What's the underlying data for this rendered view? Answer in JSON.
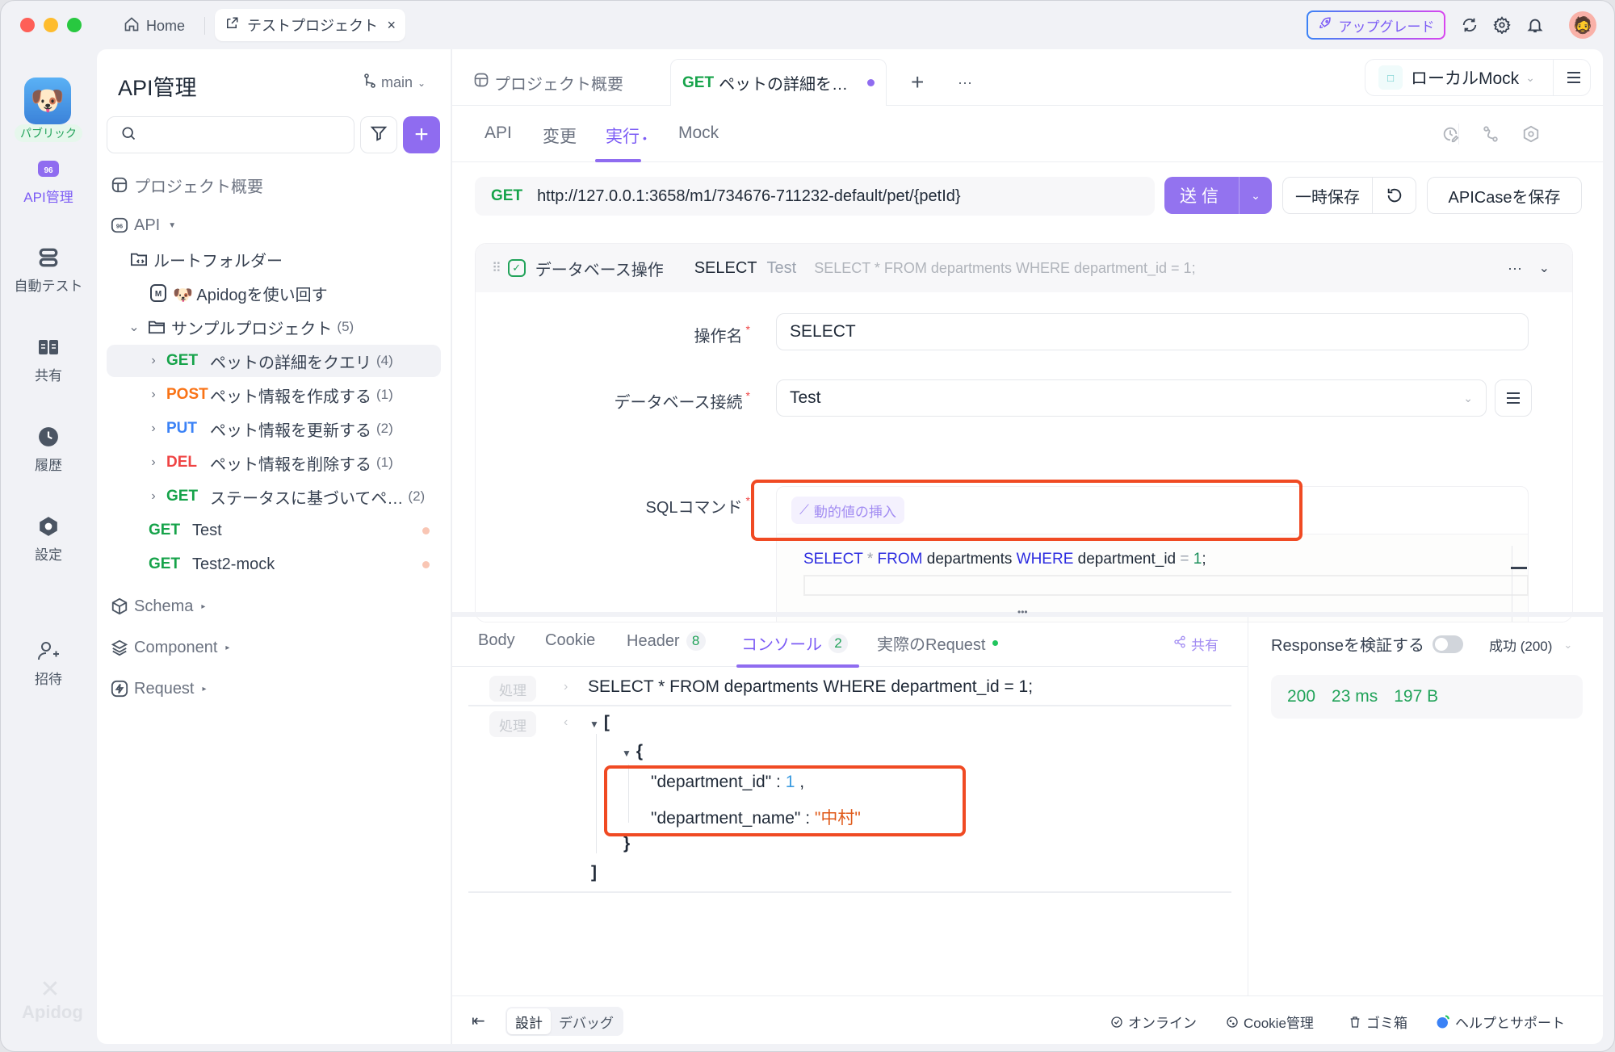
{
  "titlebar": {
    "home_tab": "Home",
    "project_tab": "テストプロジェクト",
    "close_glyph": "×",
    "upgrade_label": "アップグレード"
  },
  "rail": {
    "badge": "パブリック",
    "items": [
      {
        "label": "API管理",
        "icon": "api-icon",
        "active": true
      },
      {
        "label": "自動テスト",
        "icon": "automation-icon",
        "active": false
      },
      {
        "label": "共有",
        "icon": "book-icon",
        "active": false
      },
      {
        "label": "履歴",
        "icon": "clock-icon",
        "active": false
      },
      {
        "label": "設定",
        "icon": "settings-icon",
        "active": false
      },
      {
        "label": "招待",
        "icon": "invite-icon",
        "active": false
      }
    ],
    "footer_logo": "Apidog"
  },
  "sidebar": {
    "title": "API管理",
    "branch": "main",
    "search_placeholder": "",
    "overview": "プロジェクト概要",
    "api_label": "API",
    "root_folder": "ルートフォルダー",
    "doc_item": "🐶 Apidogを使い回す",
    "sample_folder": "サンプルプロジェクト",
    "sample_count": "(5)",
    "endpoints": [
      {
        "method": "GET",
        "name": "ペットの詳細をクエリ",
        "count": "(4)",
        "selected": true
      },
      {
        "method": "POST",
        "name": "ペット情報を作成する",
        "count": "(1)",
        "selected": false
      },
      {
        "method": "PUT",
        "name": "ペット情報を更新する",
        "count": "(2)",
        "selected": false
      },
      {
        "method": "DEL",
        "name": "ペット情報を削除する",
        "count": "(1)",
        "selected": false
      },
      {
        "method": "GET",
        "name": "ステータスに基づいてペ…",
        "count": "(2)",
        "selected": false
      }
    ],
    "loose_items": [
      {
        "method": "GET",
        "name": "Test"
      },
      {
        "method": "GET",
        "name": "Test2-mock"
      }
    ],
    "sections": [
      "Schema",
      "Component",
      "Request"
    ]
  },
  "doc_tabs": {
    "overview": "プロジェクト概要",
    "active_method": "GET",
    "active_title": "ペットの詳細を…",
    "add_glyph": "+",
    "more_glyph": "···",
    "environment": "ローカルMock"
  },
  "sub_tabs": [
    "API",
    "変更",
    "実行",
    "Mock"
  ],
  "sub_tab_active_dot": "•",
  "request": {
    "method": "GET",
    "url": "http://127.0.0.1:3658/m1/734676-711232-default/pet/{petId}",
    "send_label": "送信",
    "save_label": "一時保存",
    "save_case_label": "APICaseを保存"
  },
  "db_operation": {
    "type_label": "データベース操作",
    "op_name": "SELECT",
    "connection": "Test",
    "sql_preview": "SELECT * FROM departments WHERE department_id = 1;",
    "fields": {
      "op_name_label": "操作名",
      "op_name_value": "SELECT",
      "connection_label": "データベース接続",
      "connection_value": "Test",
      "sql_label": "SQLコマンド",
      "insert_dynamic": "動的値の挿入",
      "required_mark": "*"
    },
    "sql_tokens": {
      "k1": "SELECT",
      "star": " * ",
      "k2": "FROM",
      "t1": " departments ",
      "k3": "WHERE",
      "t2": " department_id ",
      "eq": "=",
      "n1": " 1",
      "end": ";"
    }
  },
  "response_tabs": {
    "items": [
      {
        "label": "Body",
        "badge": null
      },
      {
        "label": "Cookie",
        "badge": null
      },
      {
        "label": "Header",
        "badge": "8"
      },
      {
        "label": "コンソール",
        "badge": "2"
      },
      {
        "label": "実際のRequest",
        "badge": null
      }
    ],
    "active": "コンソール",
    "share": "共有"
  },
  "console": {
    "badge_label": "処理",
    "query": "SELECT * FROM departments WHERE department_id = 1;",
    "result": {
      "open_bracket": "[",
      "open_brace": "{",
      "key1": "\"department_id\"",
      "val1": "1",
      "key2": "\"department_name\"",
      "val2": "\"中村\"",
      "close_brace": "}",
      "close_bracket": "]"
    }
  },
  "response_meta": {
    "verify_label": "Responseを検証する",
    "verify_enabled": false,
    "status_select": "成功 (200)",
    "status_code": "200",
    "time": "23 ms",
    "size": "197 B"
  },
  "footer": {
    "modes": [
      "設計",
      "デバッグ"
    ],
    "active_mode": "設計",
    "links": [
      "オンライン",
      "Cookie管理",
      "ゴミ箱",
      "ヘルプとサポート"
    ]
  },
  "colors": {
    "accent": "#8f6cf0",
    "get": "#16a34a",
    "post": "#f97316",
    "put": "#3b82f6",
    "del": "#ef4444",
    "highlight": "#f04a23"
  }
}
